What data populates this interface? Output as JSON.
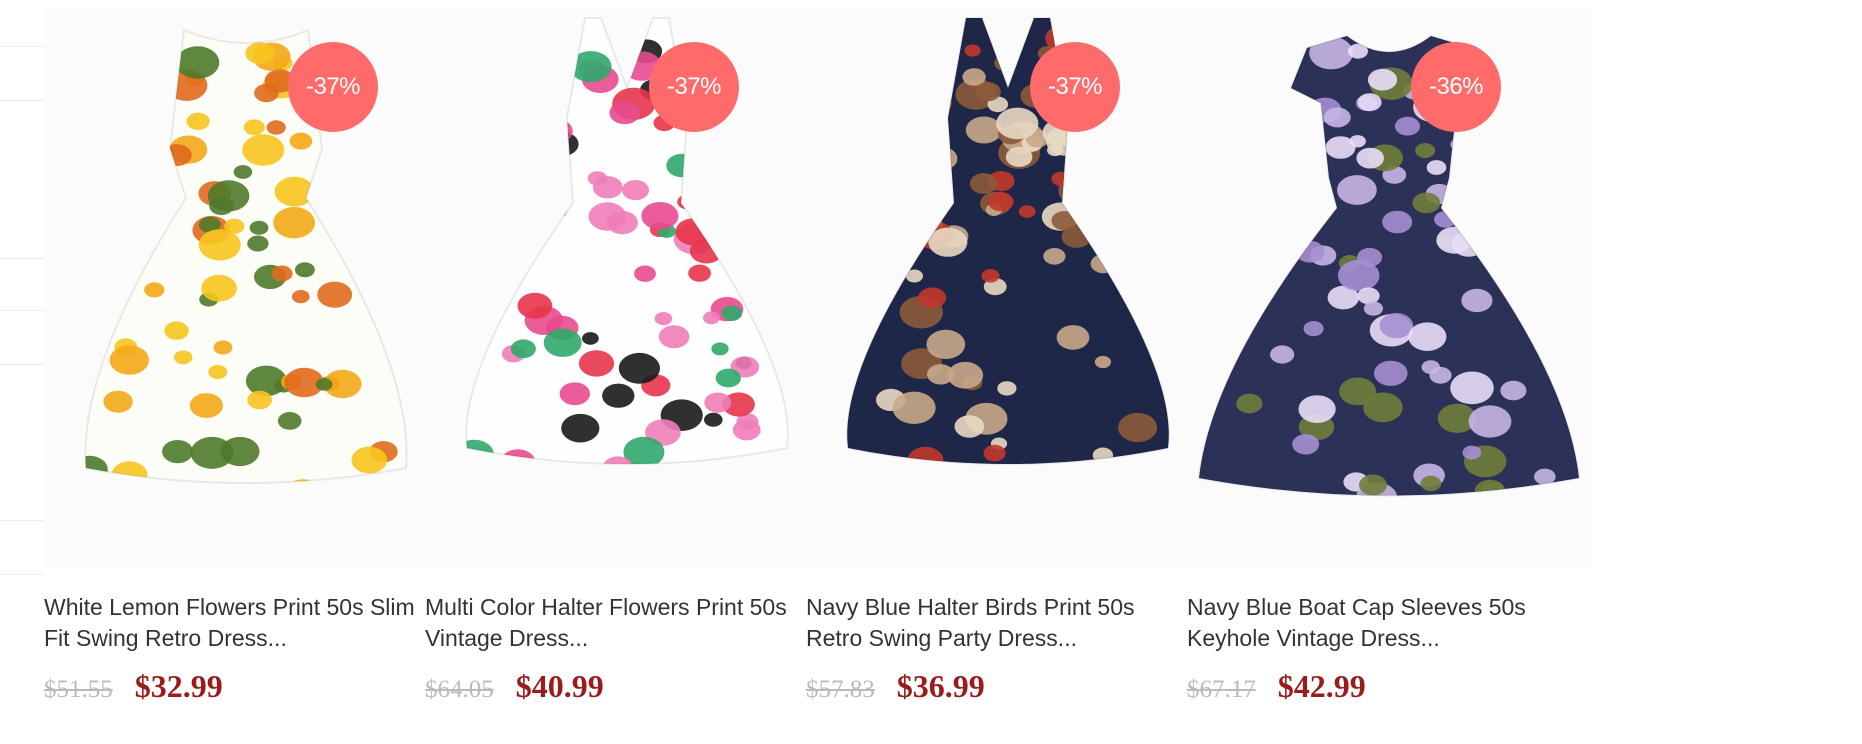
{
  "colors": {
    "badge_bg": "#ff6b6b",
    "price": "#9b1c1c",
    "old_price": "#bbbbbb",
    "title": "#333333"
  },
  "products": [
    {
      "title": "White Lemon Flowers Print 50s Slim Fit Swing Retro Dress...",
      "discount": "-37%",
      "old_price": "$51.55",
      "price": "$32.99",
      "image": {
        "icon": "dress-image",
        "base": "#fdfdf7",
        "pattern": [
          "#f7c51e",
          "#f3a916",
          "#4f7a2a",
          "#e06a1d"
        ]
      }
    },
    {
      "title": "Multi Color Halter Flowers Print 50s Vintage Dress...",
      "discount": "-37%",
      "old_price": "$64.05",
      "price": "$40.99",
      "image": {
        "icon": "dress-image",
        "base": "#fefefe",
        "pattern": [
          "#e84a8f",
          "#f07db8",
          "#2fa86a",
          "#1a1a1a",
          "#e8344a"
        ]
      }
    },
    {
      "title": "Navy Blue Halter Birds Print 50s Retro Swing Party Dress...",
      "discount": "-37%",
      "old_price": "$57.83",
      "price": "$36.99",
      "image": {
        "icon": "dress-image",
        "base": "#1f2748",
        "pattern": [
          "#c9a98a",
          "#8c5b3b",
          "#c0392b",
          "#e8d9c2"
        ]
      }
    },
    {
      "title": "Navy Blue Boat Cap Sleeves 50s Keyhole Vintage Dress...",
      "discount": "-36%",
      "old_price": "$67.17",
      "price": "$42.99",
      "image": {
        "icon": "dress-image",
        "base": "#2c3158",
        "pattern": [
          "#c8b6e6",
          "#a58fd3",
          "#e9def7",
          "#6f7d3a"
        ]
      }
    }
  ]
}
